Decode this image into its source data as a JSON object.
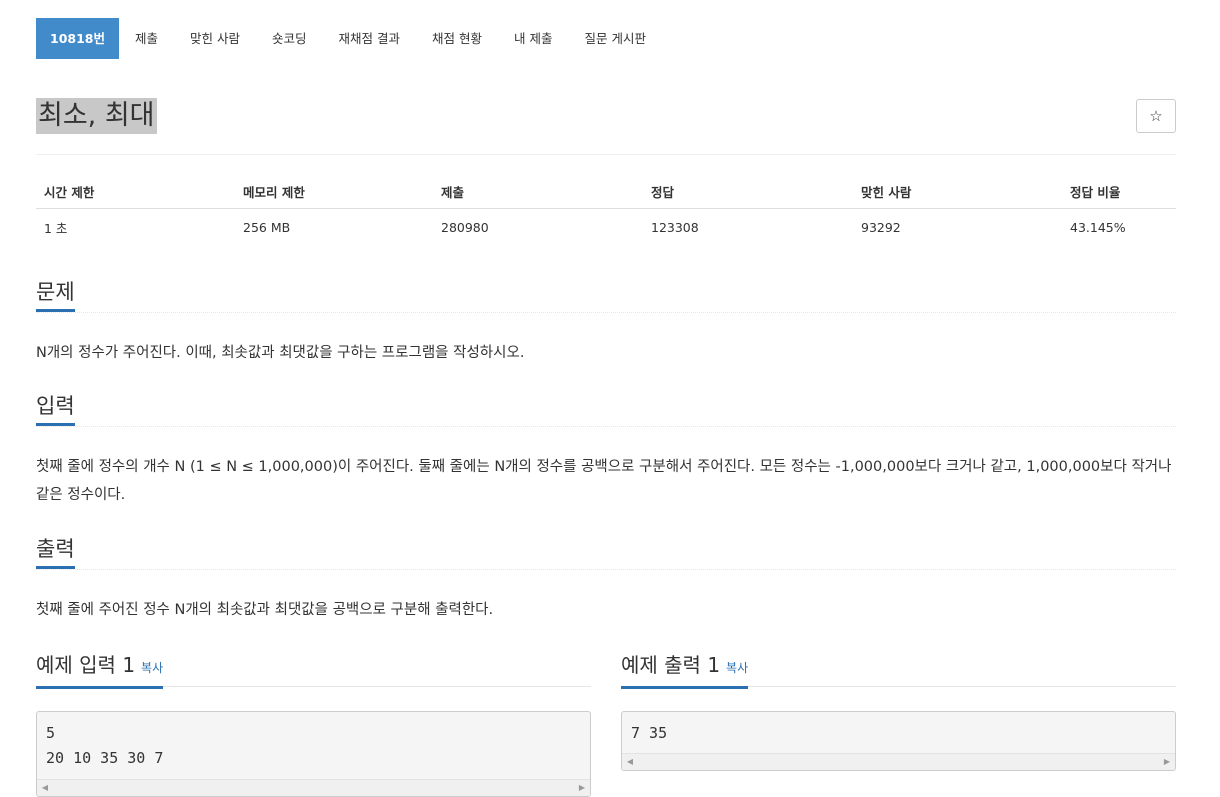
{
  "nav": {
    "tabs": [
      "10818번",
      "제출",
      "맞힌 사람",
      "숏코딩",
      "재채점 결과",
      "채점 현황",
      "내 제출",
      "질문 게시판"
    ]
  },
  "problem": {
    "title": "최소, 최대",
    "star_icon": "☆"
  },
  "stats": {
    "headers": [
      "시간 제한",
      "메모리 제한",
      "제출",
      "정답",
      "맞힌 사람",
      "정답 비율"
    ],
    "values": [
      "1 초",
      "256 MB",
      "280980",
      "123308",
      "93292",
      "43.145%"
    ]
  },
  "sections": {
    "problem": {
      "heading": "문제",
      "text": "N개의 정수가 주어진다. 이때, 최솟값과 최댓값을 구하는 프로그램을 작성하시오."
    },
    "input": {
      "heading": "입력",
      "text": "첫째 줄에 정수의 개수 N (1 ≤ N ≤ 1,000,000)이 주어진다. 둘째 줄에는 N개의 정수를 공백으로 구분해서 주어진다. 모든 정수는 -1,000,000보다 크거나 같고, 1,000,000보다 작거나 같은 정수이다."
    },
    "output": {
      "heading": "출력",
      "text": "첫째 줄에 주어진 정수 N개의 최솟값과 최댓값을 공백으로 구분해 출력한다."
    }
  },
  "examples": {
    "input": {
      "heading": "예제 입력 1",
      "copy_label": "복사",
      "content": "5\n20 10 35 30 7"
    },
    "output": {
      "heading": "예제 출력 1",
      "copy_label": "복사",
      "content": "7 35"
    }
  },
  "colors": {
    "accent": "#428bca",
    "section_underline": "#2a6fb0",
    "title_highlight": "#c8c8c8"
  }
}
